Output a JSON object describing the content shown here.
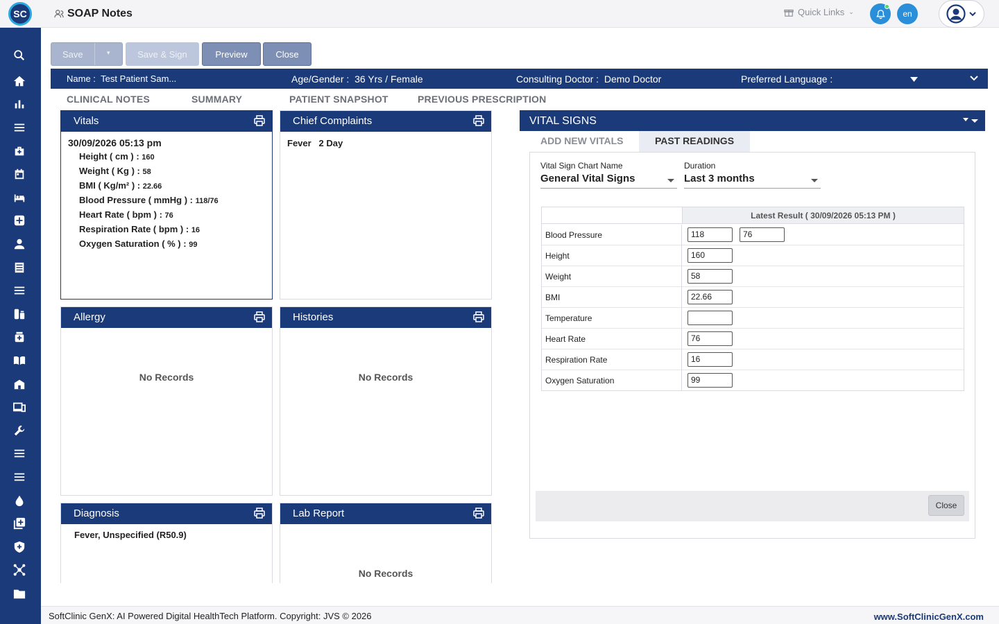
{
  "header": {
    "logo_text": "SC",
    "page_title": "SOAP Notes",
    "quick_links": "Quick Links",
    "language": "en"
  },
  "sidebar": {
    "items": [
      "search-icon",
      "home-icon",
      "bar-chart-icon",
      "menu-icon",
      "medical-bag-icon",
      "calendar-icon",
      "bed-icon",
      "plus-square-icon",
      "person-icon",
      "list-icon",
      "menu-icon",
      "pharmacy-icon",
      "medicine-bottle-icon",
      "book-icon",
      "building-icon",
      "devices-icon",
      "wrench-icon",
      "menu-icon",
      "menu-icon",
      "drop-icon",
      "add-box-icon",
      "shield-icon",
      "network-icon",
      "folder-icon"
    ]
  },
  "actions": {
    "save": "Save",
    "save_sign": "Save & Sign",
    "preview": "Preview",
    "close": "Close"
  },
  "patient": {
    "name_label": "Name :",
    "name_value": "Test Patient Sam...",
    "age_label": "Age/Gender :",
    "age_value": "36 Yrs / Female",
    "doctor_label": "Consulting Doctor :",
    "doctor_value": "Demo Doctor",
    "lang_label": "Preferred Language :"
  },
  "tabs": [
    "CLINICAL NOTES",
    "SUMMARY",
    "PATIENT SNAPSHOT",
    "PREVIOUS PRESCRIPTION"
  ],
  "panels": {
    "vitals": {
      "title": "Vitals",
      "date": "30/09/2026 05:13 pm",
      "rows": [
        {
          "label": "Height ( cm ) :",
          "value": "160"
        },
        {
          "label": "Weight ( Kg ) :",
          "value": "58"
        },
        {
          "label": "BMI ( Kg/m² ) :",
          "value": "22.66"
        },
        {
          "label": "Blood Pressure ( mmHg ) :",
          "value": "118/76"
        },
        {
          "label": "Heart Rate ( bpm ) :",
          "value": "76"
        },
        {
          "label": "Respiration Rate ( bpm ) :",
          "value": "16"
        },
        {
          "label": "Oxygen Saturation ( % ) :",
          "value": "99"
        }
      ]
    },
    "chief": {
      "title": "Chief Complaints",
      "complaint": "Fever",
      "duration": "2 Day"
    },
    "allergy": {
      "title": "Allergy",
      "empty": "No Records"
    },
    "histories": {
      "title": "Histories",
      "empty": "No Records"
    },
    "diagnosis": {
      "title": "Diagnosis",
      "entry": "Fever, Unspecified (R50.9)"
    },
    "lab": {
      "title": "Lab Report",
      "empty": "No Records"
    }
  },
  "vital_signs": {
    "title": "VITAL SIGNS",
    "tab_add": "ADD NEW VITALS",
    "tab_past": "PAST READINGS",
    "chart_label": "Vital Sign Chart Name",
    "chart_value": "General Vital Signs",
    "duration_label": "Duration",
    "duration_value": "Last 3 months",
    "result_header": "Latest Result ( 30/09/2026 05:13 PM )",
    "rows": [
      {
        "name": "Blood Pressure",
        "values": [
          "118",
          "76"
        ]
      },
      {
        "name": "Height",
        "values": [
          "160"
        ]
      },
      {
        "name": "Weight",
        "values": [
          "58"
        ]
      },
      {
        "name": "BMI",
        "values": [
          "22.66"
        ]
      },
      {
        "name": "Temperature",
        "values": [
          ""
        ]
      },
      {
        "name": "Heart Rate",
        "values": [
          "76"
        ]
      },
      {
        "name": "Respiration Rate",
        "values": [
          "16"
        ]
      },
      {
        "name": "Oxygen Saturation",
        "values": [
          "99"
        ]
      }
    ],
    "close": "Close"
  },
  "footer": {
    "copyright": "SoftClinic GenX: AI Powered Digital HealthTech Platform. Copyright: JVS © 2026",
    "site": "www.SoftClinicGenX.com"
  },
  "colors": {
    "brand_navy": "#1a3a7a",
    "accent_blue": "#2a8fd8"
  }
}
